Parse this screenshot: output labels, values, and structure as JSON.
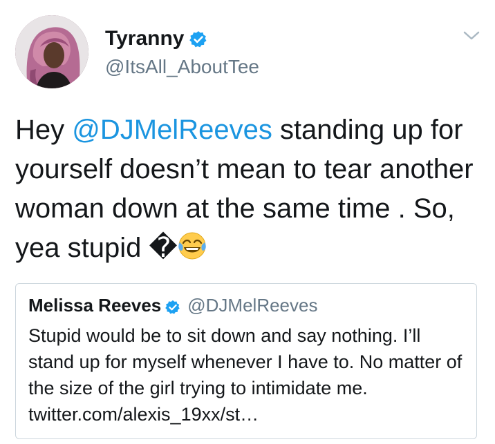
{
  "author": {
    "name": "Tyranny",
    "handle": "@ItsAll_AboutTee",
    "verified": true,
    "avatar": "profile-photo"
  },
  "menu_icon": "chevron-down-icon",
  "tweet": {
    "text_before_mention": "Hey ",
    "mention": "@DJMelReeves",
    "text_after_mention": " standing up for yourself doesn’t mean to tear another woman down at the same time . So, yea stupid ",
    "glyph": "�",
    "emoji": "face-with-tears-of-joy"
  },
  "quoted_tweet": {
    "name": "Melissa Reeves",
    "verified": true,
    "handle": "@DJMelReeves",
    "text": "Stupid would be to sit down and say nothing. I’ll stand up for myself whenever I have to. No matter of the size of the girl trying to intimidate me. twitter.com/alexis_19xx/st…"
  },
  "colors": {
    "link": "#1b95e0",
    "verified": "#1da1f2",
    "secondary_text": "#657786",
    "border": "#ccd6dd"
  }
}
